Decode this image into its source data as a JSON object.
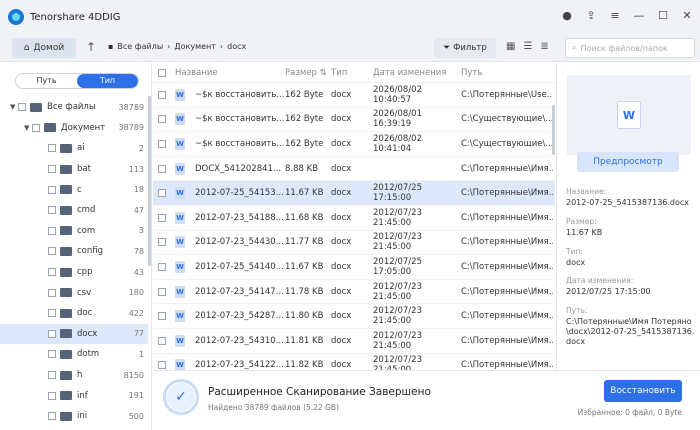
{
  "app": {
    "title": "Tenorshare 4DDIG"
  },
  "toolbar": {
    "home_label": "Домой",
    "breadcrumb": [
      "Все файлы",
      "Документ",
      "docx"
    ],
    "filter_label": "Фильтр",
    "search_placeholder": "Поиск файлов/папок"
  },
  "sidebar": {
    "tabs": [
      "Путь",
      "Тип"
    ],
    "active_tab": "Тип",
    "tree": [
      {
        "label": "Все файлы",
        "count": "38789"
      },
      {
        "label": "Документ",
        "count": "38789"
      },
      {
        "label": "ai",
        "count": "2"
      },
      {
        "label": "bat",
        "count": "113"
      },
      {
        "label": "c",
        "count": "18"
      },
      {
        "label": "cmd",
        "count": "47"
      },
      {
        "label": "com",
        "count": "3"
      },
      {
        "label": "config",
        "count": "78"
      },
      {
        "label": "cpp",
        "count": "43"
      },
      {
        "label": "csv",
        "count": "180"
      },
      {
        "label": "doc",
        "count": "422"
      },
      {
        "label": "docx",
        "count": "77"
      },
      {
        "label": "dotm",
        "count": "1"
      },
      {
        "label": "h",
        "count": "8150"
      },
      {
        "label": "inf",
        "count": "191"
      },
      {
        "label": "ini",
        "count": "500"
      }
    ]
  },
  "table": {
    "columns": [
      "Название",
      "Размер",
      "Тип",
      "Дата изменения",
      "Путь"
    ],
    "rows": [
      {
        "name": "~$к восстановить...",
        "size": "162 Byte",
        "type": "docx",
        "date": "2026/08/02 10:40:57",
        "path": "C:\\Потерянные\\Use..."
      },
      {
        "name": "~$к восстановить...",
        "size": "162 Byte",
        "type": "docx",
        "date": "2026/08/01 16:39:19",
        "path": "C:\\Существующие\\..."
      },
      {
        "name": "~$к восстановить...",
        "size": "162 Byte",
        "type": "docx",
        "date": "2026/08/02 10:41:04",
        "path": "C:\\Существующие\\..."
      },
      {
        "name": "DOCX_541202841...",
        "size": "8.88 KB",
        "type": "docx",
        "date": "",
        "path": "C:\\Потерянные\\Имя..."
      },
      {
        "name": "2012-07-25_54153...",
        "size": "11.67 KB",
        "type": "docx",
        "date": "2012/07/25 17:15:00",
        "path": "C:\\Потерянные\\Имя..."
      },
      {
        "name": "2012-07-23_54188...",
        "size": "11.68 KB",
        "type": "docx",
        "date": "2012/07/23 21:45:00",
        "path": "C:\\Потерянные\\Имя..."
      },
      {
        "name": "2012-07-23_54430...",
        "size": "11.77 KB",
        "type": "docx",
        "date": "2012/07/23 21:45:00",
        "path": "C:\\Потерянные\\Имя..."
      },
      {
        "name": "2012-07-25_54140...",
        "size": "11.67 KB",
        "type": "docx",
        "date": "2012/07/25 17:05:00",
        "path": "C:\\Потерянные\\Имя..."
      },
      {
        "name": "2012-07-23_54147...",
        "size": "11.78 KB",
        "type": "docx",
        "date": "2012/07/23 21:45:00",
        "path": "C:\\Потерянные\\Имя..."
      },
      {
        "name": "2012-07-23_54287...",
        "size": "11.80 KB",
        "type": "docx",
        "date": "2012/07/23 21:45:00",
        "path": "C:\\Потерянные\\Имя..."
      },
      {
        "name": "2012-07-23_54310...",
        "size": "11.81 KB",
        "type": "docx",
        "date": "2012/07/23 21:45:00",
        "path": "C:\\Потерянные\\Имя..."
      },
      {
        "name": "2012-07-23_54122...",
        "size": "11.82 KB",
        "type": "docx",
        "date": "2012/07/23 21:45:00",
        "path": "C:\\Потерянные\\Имя..."
      }
    ]
  },
  "preview": {
    "button_label": "Предпросмотр",
    "name_label": "Название:",
    "name_value": "2012-07-25_5415387136.docx",
    "size_label": "Размер:",
    "size_value": "11.67 KB",
    "type_label": "Тип:",
    "type_value": "docx",
    "date_label": "Дата изменения:",
    "date_value": "2012/07/25 17:15:00",
    "path_label": "Путь:",
    "path_value": "C:\\Потерянные\\Имя Потеряно \\docx\\2012-07-25_5415387136.docx"
  },
  "status": {
    "title": "Расширенное Сканирование Завершено",
    "subtitle": "Найдено 38789 файлов (5.22 GB)",
    "restore_label": "Восстановить",
    "selected": "Избранное: 0 файл, 0 Byte"
  },
  "colors": {
    "accent": "#2c6fe6",
    "selection": "#dde8fb"
  }
}
